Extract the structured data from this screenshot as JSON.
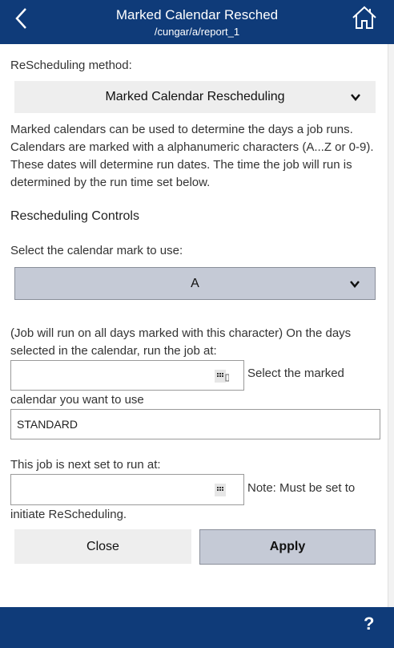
{
  "header": {
    "title": "Marked Calendar Resched",
    "subtitle": "/cungar/a/report_1",
    "back_icon": "chevron-left-icon",
    "home_icon": "home-icon"
  },
  "form": {
    "method_label": "ReScheduling method:",
    "method_value": "Marked Calendar Rescheduling",
    "method_description": "Marked calendars can be used to determine the days a job runs. Calendars are marked with a alphanumeric characters (A...Z or 0-9). These dates will determine run dates. The time the job will run is determined by the run time set below.",
    "controls_heading": "Rescheduling Controls",
    "mark_label": "Select the calendar mark to use:",
    "mark_value": "A",
    "run_note": "(Job will run on all days marked with this character) On the days selected in the calendar, run the job at:",
    "run_time_value": "",
    "calendar_label_part1": "Select the marked",
    "calendar_label_part2": "calendar you want to use",
    "calendar_value": "STANDARD",
    "next_run_label": "This job is next set to run at:",
    "next_run_value": "",
    "next_run_note_part1": "Note: Must be set to",
    "next_run_note_part2": "initiate ReScheduling."
  },
  "buttons": {
    "close": "Close",
    "apply": "Apply"
  },
  "footer": {
    "help": "?"
  },
  "colors": {
    "header_bg": "#0f3b79",
    "select_light": "#eeeeee",
    "select_active": "#c5cad6"
  }
}
